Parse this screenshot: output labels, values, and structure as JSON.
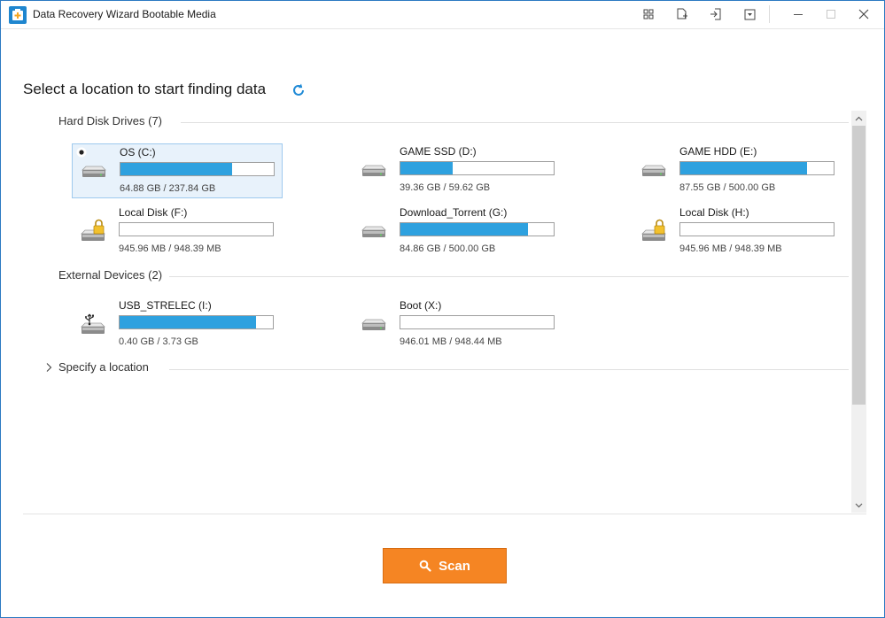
{
  "window": {
    "title": "Data Recovery Wizard Bootable Media"
  },
  "toolbar": {
    "icons": [
      "windows-icon",
      "add-file-icon",
      "export-icon",
      "dropdown-icon"
    ],
    "window_controls": [
      "minimize-icon",
      "maximize-icon",
      "close-icon"
    ]
  },
  "main": {
    "heading": "Select a location to start finding data",
    "refresh_icon": "refresh-icon"
  },
  "hard_disks": {
    "title": "Hard Disk Drives (7)",
    "drives": [
      {
        "name": "OS (C:)",
        "size": "64.88 GB / 237.84 GB",
        "used_fraction": 0.727,
        "selected": true,
        "locked": false
      },
      {
        "name": "GAME SSD (D:)",
        "size": "39.36 GB / 59.62 GB",
        "used_fraction": 0.34,
        "selected": false,
        "locked": false
      },
      {
        "name": "GAME HDD (E:)",
        "size": "87.55 GB / 500.00 GB",
        "used_fraction": 0.825,
        "selected": false,
        "locked": false
      },
      {
        "name": "Local Disk (F:)",
        "size": "945.96 MB / 948.39 MB",
        "used_fraction": 0.0,
        "selected": false,
        "locked": true
      },
      {
        "name": "Download_Torrent (G:)",
        "size": "84.86 GB / 500.00 GB",
        "used_fraction": 0.83,
        "selected": false,
        "locked": false
      },
      {
        "name": "Local Disk (H:)",
        "size": "945.96 MB / 948.39 MB",
        "used_fraction": 0.0,
        "selected": false,
        "locked": true
      }
    ]
  },
  "external": {
    "title": "External Devices (2)",
    "drives": [
      {
        "name": "USB_STRELEC (I:)",
        "size": "0.40 GB / 3.73 GB",
        "used_fraction": 0.89,
        "usb": true
      },
      {
        "name": "Boot (X:)",
        "size": "946.01 MB / 948.44 MB",
        "used_fraction": 0.0,
        "usb": false
      }
    ]
  },
  "specify": {
    "label": "Specify a location"
  },
  "actions": {
    "scan_label": "Scan"
  },
  "colors": {
    "accent": "#2ea1df",
    "scan": "#f58523",
    "selected_bg": "#e8f2fb"
  }
}
